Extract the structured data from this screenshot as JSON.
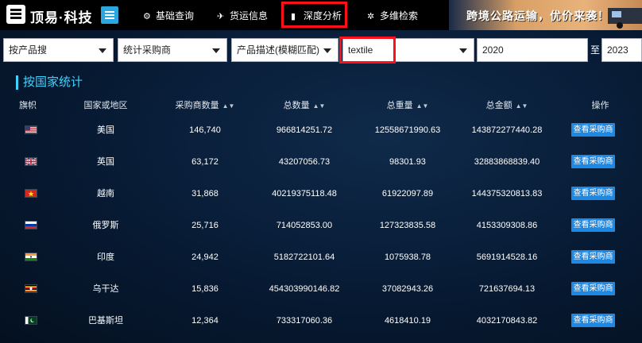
{
  "header": {
    "brand": "顶易·科技",
    "nav": [
      {
        "label": "基础查询",
        "icon": "gears-icon"
      },
      {
        "label": "货运信息",
        "icon": "plane-icon"
      },
      {
        "label": "深度分析",
        "icon": "chart-icon"
      },
      {
        "label": "多维检索",
        "icon": "settings-icon"
      }
    ],
    "promo": "跨境公路运输，优价来袭！"
  },
  "filters": {
    "search_by": "按产品搜",
    "stat_type": "统计采购商",
    "desc_mode": "产品描述(模糊匹配)",
    "keyword": "textile",
    "year_from": "2020",
    "to_label": "至",
    "year_to": "2023"
  },
  "section_title": "按国家统计",
  "table": {
    "columns": [
      "旗帜",
      "国家或地区",
      "采购商数量",
      "总数量",
      "总重量",
      "总金额",
      "操作"
    ],
    "action_label": "查看采购商",
    "rows": [
      {
        "flag": "us",
        "country": "美国",
        "buyers": "146,740",
        "qty": "966814251.72",
        "weight": "12558671990.63",
        "amount": "143872277440.28"
      },
      {
        "flag": "gb",
        "country": "英国",
        "buyers": "63,172",
        "qty": "43207056.73",
        "weight": "98301.93",
        "amount": "32883868839.40"
      },
      {
        "flag": "vn",
        "country": "越南",
        "buyers": "31,868",
        "qty": "40219375118.48",
        "weight": "61922097.89",
        "amount": "144375320813.83"
      },
      {
        "flag": "ru",
        "country": "俄罗斯",
        "buyers": "25,716",
        "qty": "714052853.00",
        "weight": "127323835.58",
        "amount": "4153309308.86"
      },
      {
        "flag": "in",
        "country": "印度",
        "buyers": "24,942",
        "qty": "5182722101.64",
        "weight": "1075938.78",
        "amount": "5691914528.16"
      },
      {
        "flag": "ug",
        "country": "乌干达",
        "buyers": "15,836",
        "qty": "454303990146.82",
        "weight": "37082943.26",
        "amount": "721637694.13"
      },
      {
        "flag": "pk",
        "country": "巴基斯坦",
        "buyers": "12,364",
        "qty": "733317060.36",
        "weight": "4618410.19",
        "amount": "4032170843.82"
      }
    ]
  }
}
